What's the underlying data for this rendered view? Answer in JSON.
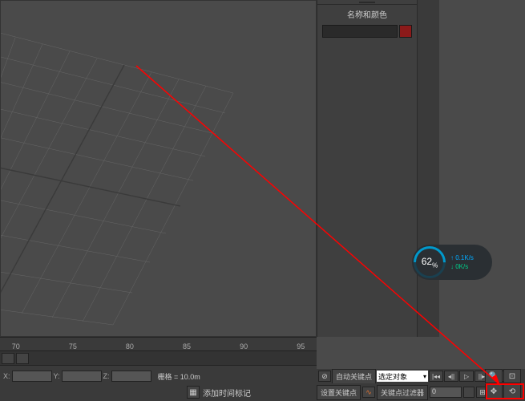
{
  "panel": {
    "name_color_header": "名称和颜色",
    "color_swatch": "#8b1a1a"
  },
  "speed": {
    "percent": "62",
    "percent_suffix": "%",
    "upload": "0.1K/s",
    "download": "0K/s"
  },
  "ruler": {
    "ticks": [
      "70",
      "75",
      "80",
      "85",
      "90",
      "95"
    ]
  },
  "coords": {
    "x_label": "X:",
    "y_label": "Y:",
    "z_label": "Z:",
    "grid_label": "栅格 = 10.0m"
  },
  "status": {
    "add_time_tag": "添加时间标记"
  },
  "keyframe": {
    "auto_key": "自动关键点",
    "set_key": "设置关键点",
    "selected_obj": "选定对象",
    "key_filter": "关键点过滤器",
    "key_icon_label": "↯",
    "frame_value": "0"
  }
}
